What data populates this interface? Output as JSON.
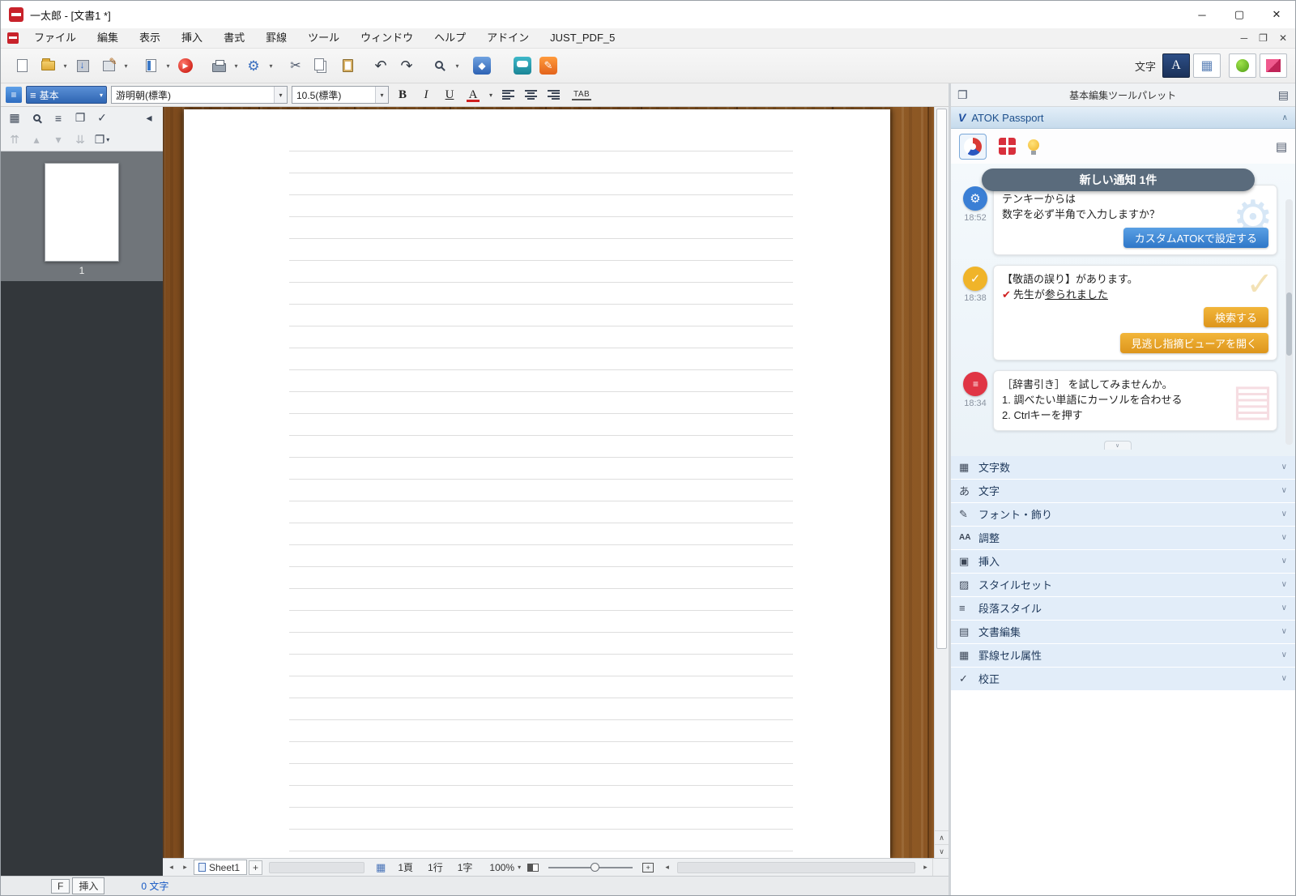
{
  "window": {
    "title": "一太郎 - [文書1 *]"
  },
  "icons": {
    "minimize": "─",
    "maximize": "▢",
    "close": "✕",
    "restore": "❐",
    "dropdown": "▾",
    "chev_up": "∧",
    "chev_down": "∨",
    "left": "◂",
    "right": "▸",
    "up": "▴",
    "down": "▾",
    "scissors": "✂",
    "undo": "↶",
    "redo": "↷",
    "gear": "⚙",
    "check": "✓",
    "check_red": "✔",
    "list": "≡",
    "pages": "❐",
    "grid": "▦",
    "doc": "▤",
    "pencil": "✎",
    "plus": "+",
    "diamond": "◆",
    "up2": "⇈",
    "down2": "⇊",
    "compass": "▶",
    "lines": "≡"
  },
  "menu": {
    "items": [
      "ファイル",
      "編集",
      "表示",
      "挿入",
      "書式",
      "罫線",
      "ツール",
      "ウィンドウ",
      "ヘルプ",
      "アドイン",
      "JUST_PDF_5"
    ]
  },
  "toolbar": {
    "char_label": "文字",
    "char_button": "A"
  },
  "format": {
    "style": "基本",
    "font": "游明朝(標準)",
    "size": "10.5(標準)",
    "bold": "B",
    "italic": "I",
    "underline": "U",
    "color_btn": "A",
    "tab": "TAB"
  },
  "thumbnail": {
    "page": "1"
  },
  "doc_bar": {
    "sheet": "Sheet1",
    "add": "+",
    "page": "1頁",
    "line": "1行",
    "char": "1字",
    "zoom": "100%"
  },
  "status": {
    "f": "F",
    "insert": "挿入",
    "count": "0 文字"
  },
  "palette": {
    "title": "基本編集ツールパレット",
    "atok_header": "ATOK Passport",
    "toast": "新しい通知 1件",
    "cards": [
      {
        "time": "18:52",
        "line1": "テンキーからは",
        "line2": "数字を必ず半角で入力しますか？",
        "button": "カスタムATOKで設定する"
      },
      {
        "time": "18:38",
        "line1": "【敬語の誤り】があります。",
        "line2_prefix": "先生が",
        "line2_underline": "参られました",
        "button1": "検索する",
        "button2": "見逃し指摘ビューアを開く"
      },
      {
        "time": "18:34",
        "line1": "［辞書引き］ を試してみませんか。",
        "line2": "1. 調べたい単語にカーソルを合わせる",
        "line3": "2. Ctrlキーを押す"
      }
    ],
    "sections": [
      {
        "label": "文字数",
        "icon": "▦"
      },
      {
        "label": "文字",
        "icon": "あ"
      },
      {
        "label": "フォント・飾り",
        "icon": "✎"
      },
      {
        "label": "調整",
        "icon": "AA"
      },
      {
        "label": "挿入",
        "icon": "▣"
      },
      {
        "label": "スタイルセット",
        "icon": "▨"
      },
      {
        "label": "段落スタイル",
        "icon": "≡"
      },
      {
        "label": "文書編集",
        "icon": "▤"
      },
      {
        "label": "罫線セル属性",
        "icon": "▦"
      },
      {
        "label": "校正",
        "icon": "✓"
      }
    ]
  },
  "colors": {
    "accent_blue": "#3a7fd5",
    "accent_yellow": "#f0b429",
    "atok_red": "#d8303c",
    "wood_brown": "#8a5523",
    "count_blue": "#1558c4"
  }
}
